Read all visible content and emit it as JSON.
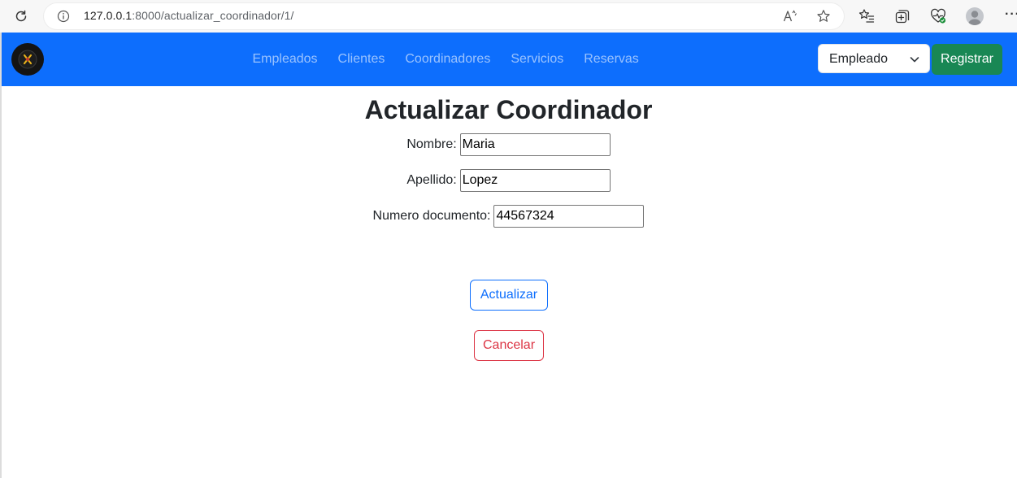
{
  "browser": {
    "url_host": "127.0.0.1",
    "url_path": ":8000/actualizar_coordinador/1/"
  },
  "navbar": {
    "links": [
      "Empleados",
      "Clientes",
      "Coordinadores",
      "Servicios",
      "Reservas"
    ],
    "role_select_value": "Empleado",
    "register_label": "Registrar"
  },
  "form": {
    "title": "Actualizar Coordinador",
    "fields": [
      {
        "label": "Nombre:",
        "value": "Maria"
      },
      {
        "label": "Apellido:",
        "value": "Lopez"
      },
      {
        "label": "Numero documento:",
        "value": "44567324"
      }
    ],
    "update_label": "Actualizar",
    "cancel_label": "Cancelar"
  },
  "colors": {
    "navbar": "#0d6efd",
    "register": "#198754",
    "update": "#0d6efd",
    "cancel": "#dc3545"
  },
  "icons": {
    "browser": [
      "reload-icon",
      "info-icon",
      "read-aloud-icon",
      "favorite-star-icon",
      "favorites-list-icon",
      "collections-icon",
      "browser-essentials-icon",
      "profile-icon",
      "more-icon"
    ],
    "brand": "logo-icon",
    "select": "chevron-down-icon"
  }
}
